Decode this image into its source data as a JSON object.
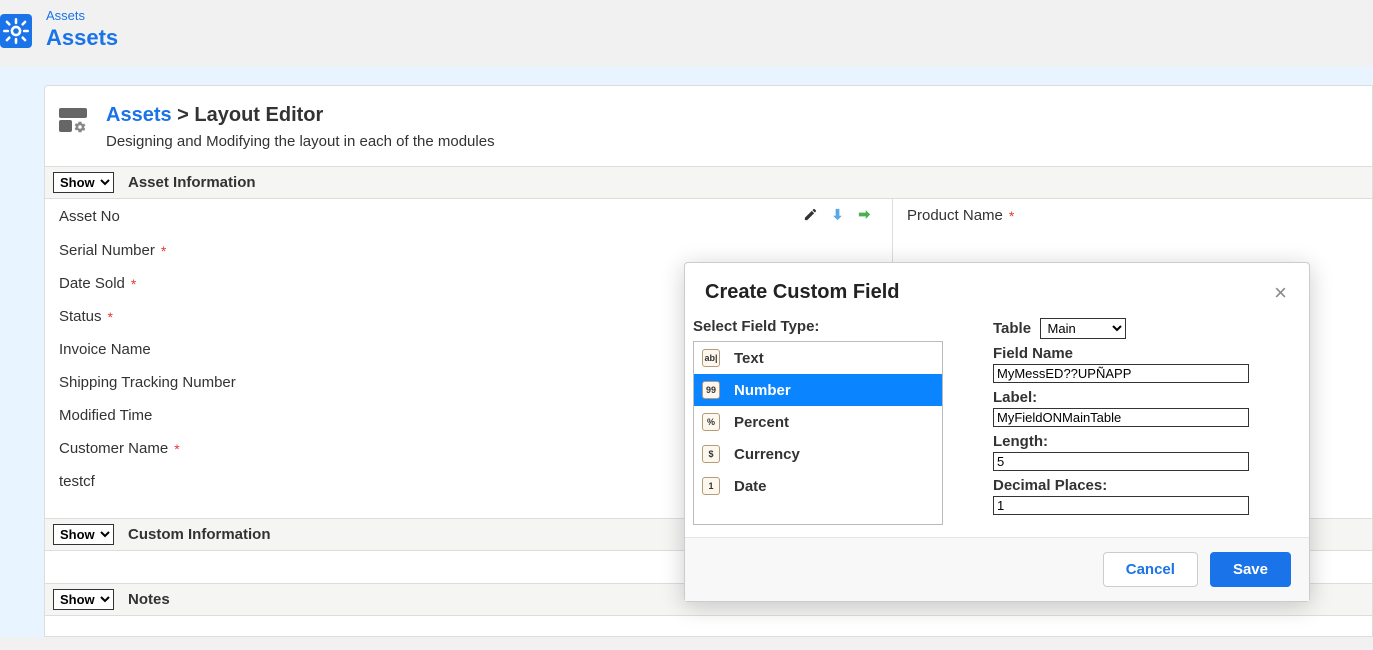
{
  "top": {
    "breadcrumb": "Assets",
    "title": "Assets"
  },
  "panel": {
    "link": "Assets",
    "separator": " > ",
    "heading": "Layout Editor",
    "desc": "Designing and Modifying the layout in each of the modules"
  },
  "showOption": "Show",
  "sections": [
    {
      "title": "Asset Information"
    },
    {
      "title": "Custom Information"
    },
    {
      "title": "Notes"
    }
  ],
  "leftFields": [
    {
      "label": "Asset No",
      "required": false,
      "icons": true
    },
    {
      "label": "Serial Number",
      "required": true
    },
    {
      "label": "Date Sold",
      "required": true
    },
    {
      "label": "Status",
      "required": true
    },
    {
      "label": "Invoice Name",
      "required": false
    },
    {
      "label": "Shipping Tracking Number",
      "required": false
    },
    {
      "label": "Modified Time",
      "required": false
    },
    {
      "label": "Customer Name",
      "required": true
    },
    {
      "label": "testcf",
      "required": false
    }
  ],
  "rightFields": [
    {
      "label": "Product Name",
      "required": true
    }
  ],
  "modal": {
    "title": "Create Custom Field",
    "selectLabel": "Select Field Type:",
    "types": [
      {
        "icon": "ab|",
        "label": "Text"
      },
      {
        "icon": "99",
        "label": "Number",
        "selected": true
      },
      {
        "icon": "%",
        "label": "Percent"
      },
      {
        "icon": "$",
        "label": "Currency"
      },
      {
        "icon": "1",
        "label": "Date"
      }
    ],
    "tableLabel": "Table",
    "tableValue": "Main",
    "fieldNameLabel": "Field Name",
    "fieldNameValue": "MyMessED??UPÑAPP",
    "labelLabel": "Label:",
    "labelValue": "MyFieldONMainTable",
    "lengthLabel": "Length:",
    "lengthValue": "5",
    "decimalLabel": "Decimal Places:",
    "decimalValue": "1",
    "cancel": "Cancel",
    "save": "Save"
  }
}
